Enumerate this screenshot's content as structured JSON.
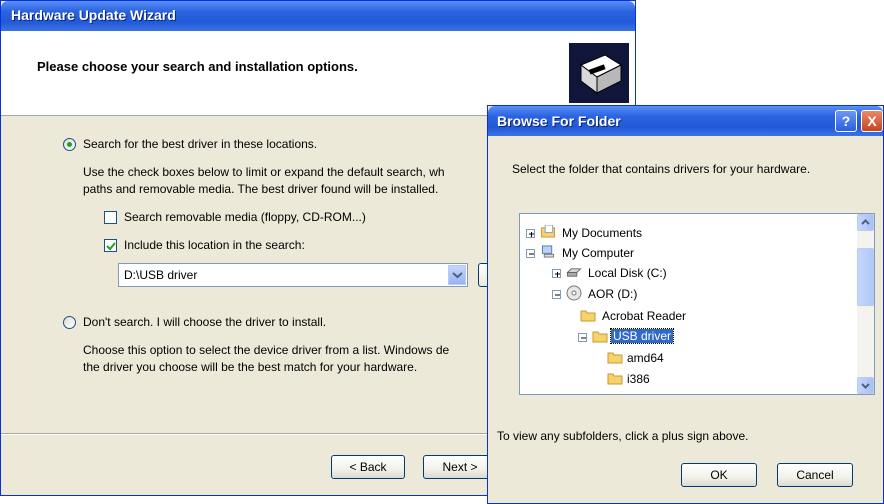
{
  "wizard": {
    "title": "Hardware Update Wizard",
    "heading": "Please choose your search and installation options.",
    "option_search": "Search for the best driver in these locations.",
    "search_desc_line1": "Use the check boxes below to limit or expand the default search, wh",
    "search_desc_line2": "paths and removable media. The best driver found will be installed.",
    "check_removable": "Search removable media (floppy, CD-ROM...)",
    "check_include": "Include this location in the search:",
    "location_value": "D:\\USB driver",
    "option_dont_search": "Don't search. I will choose the driver to install.",
    "dont_desc_line1": "Choose this option to select the device driver from a list.  Windows de",
    "dont_desc_line2": "the driver you choose will be the best match for your hardware.",
    "back_label": "< Back",
    "next_label": "Next >"
  },
  "browse": {
    "title": "Browse For Folder",
    "help_label": "?",
    "close_label": "X",
    "instruction": "Select the folder that contains drivers for your hardware.",
    "tree": {
      "my_documents": "My Documents",
      "my_computer": "My Computer",
      "local_disk": "Local Disk (C:)",
      "aor": "AOR (D:)",
      "acrobat": "Acrobat Reader",
      "usb_driver": "USB driver",
      "amd64": "amd64",
      "i386": "i386"
    },
    "hint": "To view any subfolders, click a plus sign above.",
    "ok_label": "OK",
    "cancel_label": "Cancel"
  },
  "colors": {
    "titlebar": "#2a63e0",
    "selection": "#316ac5",
    "folder": "#f5d26b"
  }
}
